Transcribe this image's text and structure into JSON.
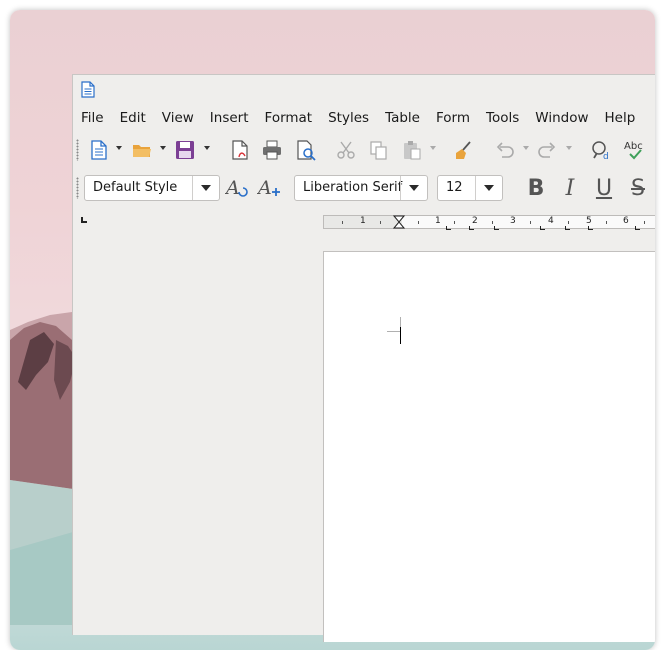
{
  "menu": [
    "File",
    "Edit",
    "View",
    "Insert",
    "Format",
    "Styles",
    "Table",
    "Form",
    "Tools",
    "Window",
    "Help"
  ],
  "toolbar": {
    "icons": [
      "new-document-icon",
      "open-folder-icon",
      "save-icon",
      "export-pdf-icon",
      "print-icon",
      "print-preview-icon",
      "cut-icon",
      "copy-icon",
      "paste-icon",
      "clone-formatting-icon",
      "undo-icon",
      "redo-icon",
      "find-replace-icon",
      "spellcheck-icon"
    ],
    "spellcheck_label": "Abc"
  },
  "formatting": {
    "paragraph_style": "Default Style",
    "font_name": "Liberation Serif",
    "font_size": "12",
    "bold_label": "B",
    "italic_label": "I",
    "underline_label": "U",
    "strike_label": "S"
  },
  "ruler": {
    "labels": [
      "1",
      "1",
      "2",
      "3",
      "4",
      "5",
      "6"
    ]
  },
  "colors": {
    "save_purple": "#7c3f94",
    "doc_blue": "#2a6fc9",
    "folder_orange": "#e9a33c",
    "check_green": "#3fa05a"
  }
}
